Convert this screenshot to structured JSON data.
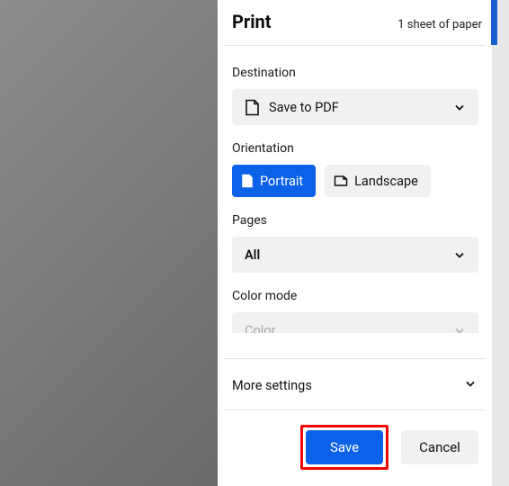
{
  "header": {
    "title": "Print",
    "sheet_count": "1 sheet of paper"
  },
  "destination": {
    "label": "Destination",
    "selected": "Save to PDF"
  },
  "orientation": {
    "label": "Orientation",
    "portrait": "Portrait",
    "landscape": "Landscape",
    "selected": "portrait"
  },
  "pages": {
    "label": "Pages",
    "selected": "All"
  },
  "color_mode": {
    "label": "Color mode",
    "selected": "Color",
    "disabled": true
  },
  "more_settings": {
    "label": "More settings"
  },
  "footer": {
    "save": "Save",
    "cancel": "Cancel"
  },
  "colors": {
    "accent": "#0b61e7",
    "highlight": "#f00601"
  }
}
